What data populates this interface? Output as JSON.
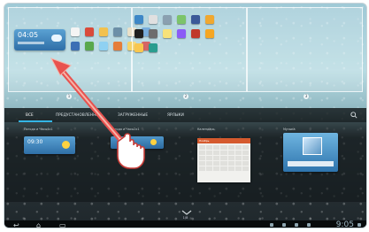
{
  "home": {
    "clock_widget": {
      "time": "04:05"
    },
    "page_markers": [
      "1",
      "2",
      "3"
    ]
  },
  "widgets_tabs": [
    {
      "label": "ВСЕ",
      "active": true
    },
    {
      "label": "ПРЕДУСТАНОВЛЕННЫЕ",
      "active": false
    },
    {
      "label": "ЗАГРУЖЕННЫЕ",
      "active": false
    },
    {
      "label": "ЯРЛЫКИ",
      "active": false
    }
  ],
  "widgets": [
    {
      "label": "Погода и Часы4x1",
      "time": "09:30"
    },
    {
      "label": "Погода и Часы2x1"
    },
    {
      "label": "Календарь",
      "header": "Ноябрь"
    },
    {
      "label": "Музыка"
    }
  ],
  "pager": "1/8",
  "statusbar": {
    "time": "9:05"
  },
  "colors": {
    "accent": "#33b5e5",
    "arrow": "#e8524f",
    "tab_bar": "#0a0e10"
  },
  "icons": [
    "back-icon",
    "home-icon",
    "recent-apps-icon",
    "search-icon",
    "chevron-down-icon",
    "hand-pointer-icon",
    "wifi-icon",
    "battery-icon"
  ]
}
